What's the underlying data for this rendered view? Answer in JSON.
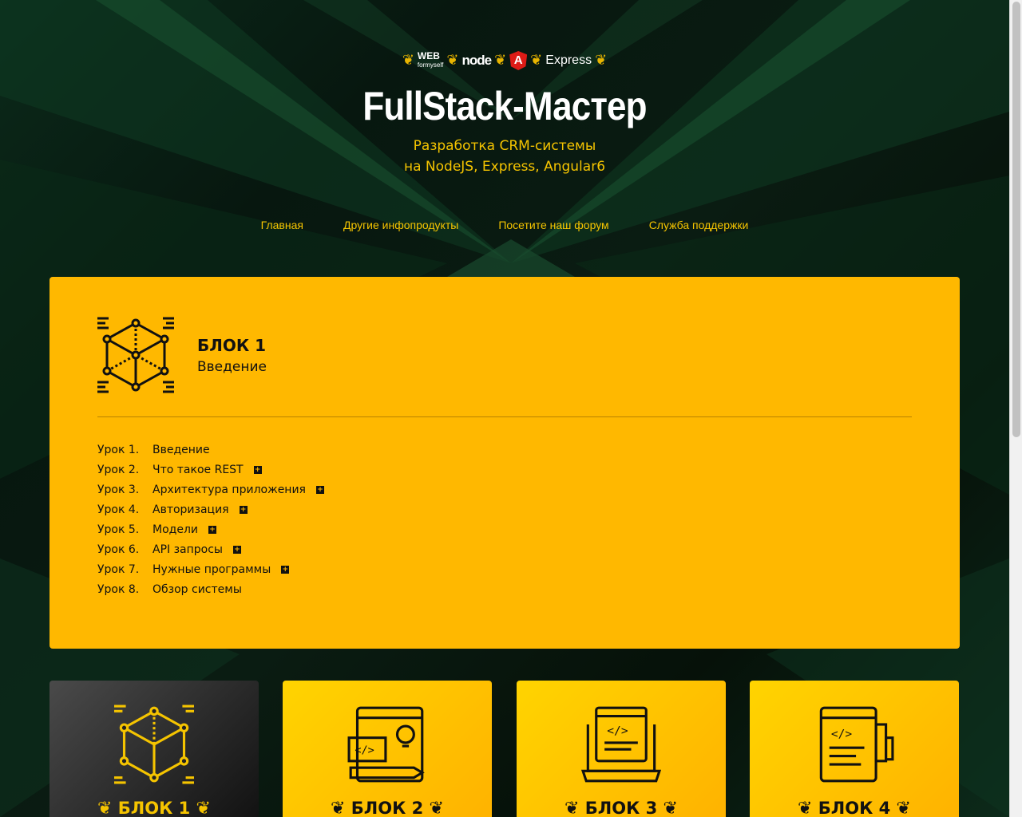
{
  "header": {
    "logos": {
      "web_top": "WEB",
      "web_bottom": "formyself",
      "node": "node",
      "angular": "A",
      "express": "Express"
    },
    "title": "FullStack-Мастер",
    "subtitle_line1": "Разработка CRM-системы",
    "subtitle_line2": "на NodeJS, Express, Angular6"
  },
  "nav": {
    "items": [
      {
        "label": "Главная"
      },
      {
        "label": "Другие инфопродукты"
      },
      {
        "label": "Посетите наш форум"
      },
      {
        "label": "Служба поддержки"
      }
    ]
  },
  "block": {
    "name": "БЛОК 1",
    "description": "Введение",
    "lessons": [
      {
        "num": "Урок 1.",
        "title": "Введение",
        "has_plus": false
      },
      {
        "num": "Урок 2.",
        "title": "Что такое REST",
        "has_plus": true
      },
      {
        "num": "Урок 3.",
        "title": "Архитектура приложения",
        "has_plus": true
      },
      {
        "num": "Урок 4.",
        "title": "Авторизация",
        "has_plus": true
      },
      {
        "num": "Урок 5.",
        "title": "Модели",
        "has_plus": true
      },
      {
        "num": "Урок 6.",
        "title": "API запросы",
        "has_plus": true
      },
      {
        "num": "Урок 7.",
        "title": "Нужные программы",
        "has_plus": true
      },
      {
        "num": "Урок 8.",
        "title": "Обзор системы",
        "has_plus": false
      }
    ]
  },
  "cards": [
    {
      "label": "БЛОК 1",
      "icon": "cube-icon",
      "active": true
    },
    {
      "label": "БЛОК 2",
      "icon": "design-icon",
      "active": false
    },
    {
      "label": "БЛОК 3",
      "icon": "laptop-code-icon",
      "active": false
    },
    {
      "label": "БЛОК 4",
      "icon": "phone-code-icon",
      "active": false
    }
  ],
  "colors": {
    "accent": "#ffb800",
    "nav_text": "#f5c400",
    "background": "#06140d"
  }
}
